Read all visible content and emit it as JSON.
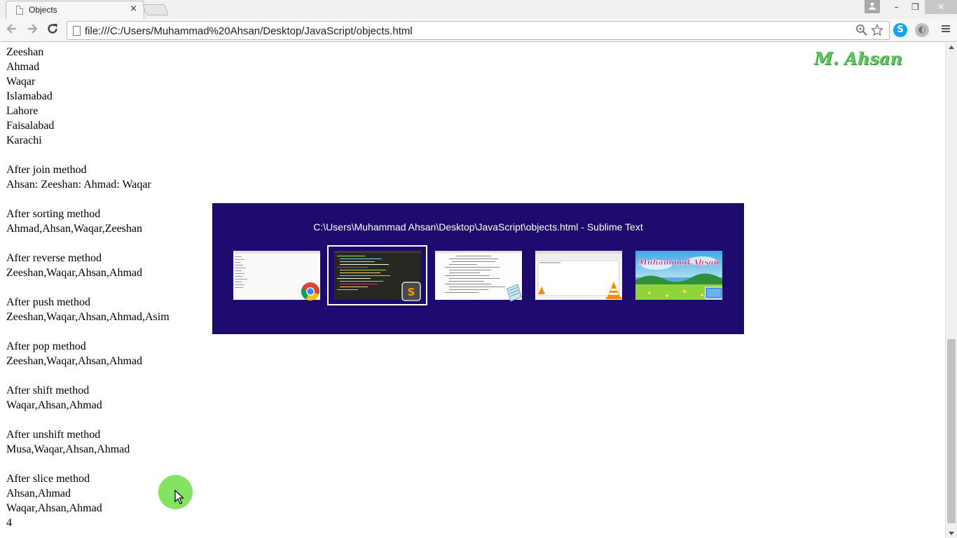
{
  "browser": {
    "tab_title": "Objects",
    "tab_close": "×",
    "url": "file:///C:/Users/Muhammad%20Ahsan/Desktop/JavaScript/objects.html",
    "window_controls": {
      "minimize": "–",
      "restore": "❐",
      "close": "✕"
    }
  },
  "page": {
    "watermark": "M. Ahsan",
    "lines": [
      "Zeeshan",
      "Ahmad",
      "Waqar",
      "Islamabad",
      "Lahore",
      "Faisalabad",
      "Karachi",
      "",
      "After join method",
      "Ahsan: Zeeshan: Ahmad: Waqar",
      "",
      "After sorting method",
      "Ahmad,Ahsan,Waqar,Zeeshan",
      "",
      "After reverse method",
      "Zeeshan,Waqar,Ahsan,Ahmad",
      "",
      "After push method",
      "Zeeshan,Waqar,Ahsan,Ahmad,Asim",
      "",
      "After pop method",
      "Zeeshan,Waqar,Ahsan,Ahmad",
      "",
      "After shift method",
      "Waqar,Ahsan,Ahmad",
      "",
      "After unshift method",
      "Musa,Waqar,Ahsan,Ahmad",
      "",
      "After slice method",
      "Ahsan,Ahmad",
      "Waqar,Ahsan,Ahmad",
      "4"
    ]
  },
  "task_switcher": {
    "title": "C:\\Users\\Muhammad Ahsan\\Desktop\\JavaScript\\objects.html - Sublime Text",
    "windows": [
      {
        "app": "chrome-icon"
      },
      {
        "app": "sublime-text-icon",
        "selected": true,
        "badge_letter": "S"
      },
      {
        "app": "notepad-icon"
      },
      {
        "app": "vlc-icon"
      },
      {
        "app": "desktop-icon",
        "wallpaper_text": "Muhammad Ahsan"
      }
    ]
  },
  "colors": {
    "switcher_bg": "#1c0a6e",
    "watermark": "#5ac85a",
    "click_indicator": "#7de35a"
  }
}
